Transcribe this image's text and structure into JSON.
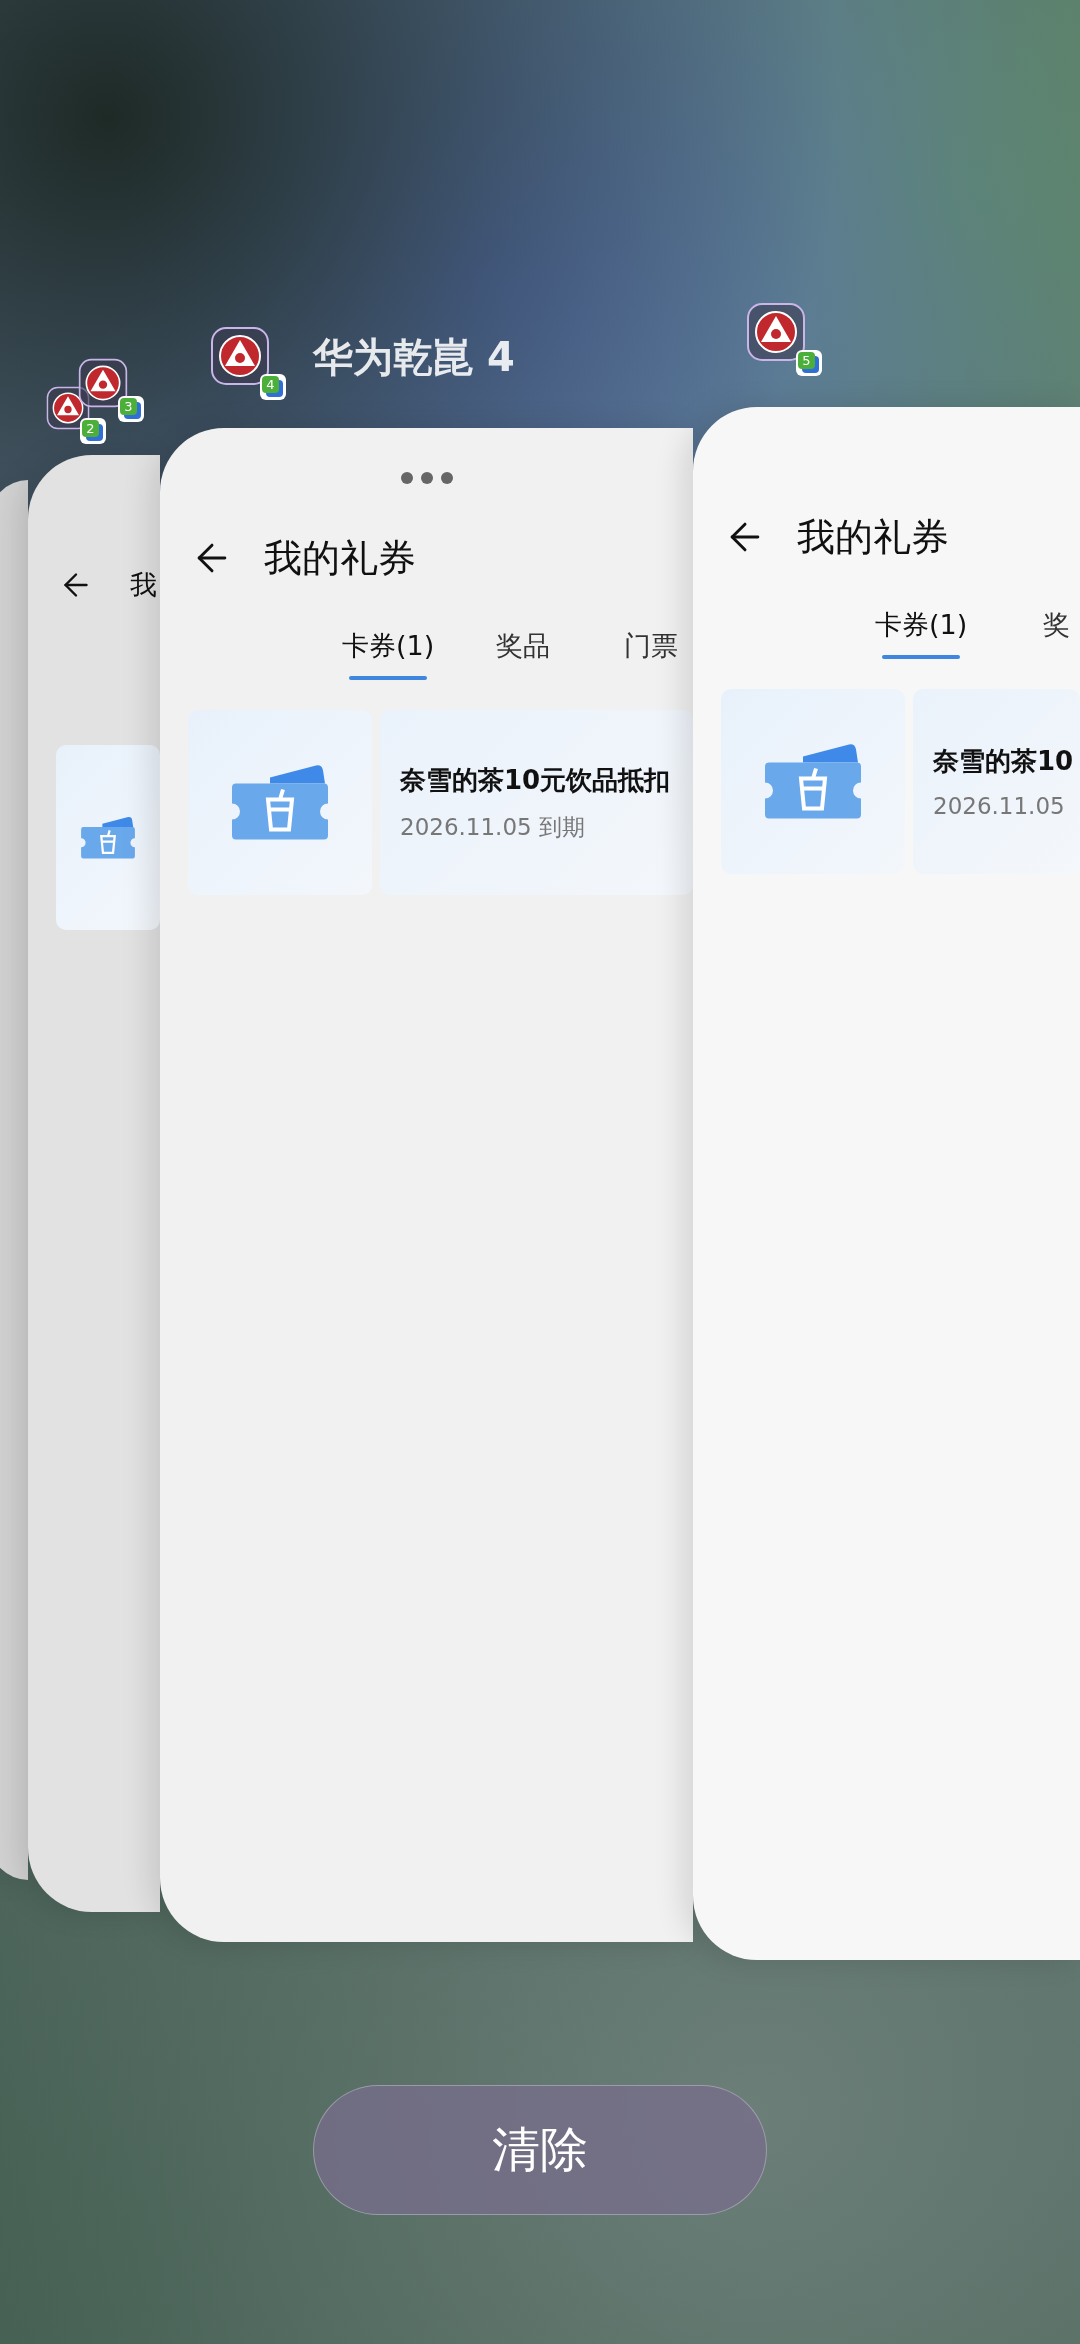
{
  "app_title": "华为乾崑 4",
  "windows": [
    {
      "badge": "2"
    },
    {
      "badge": "3",
      "title": "我",
      "has_coupon": true
    },
    {
      "badge": "4",
      "dots": true,
      "title": "我的礼券",
      "tabs": [
        {
          "label": "卡券(1)",
          "selected": true
        },
        {
          "label": "奖品",
          "selected": false
        },
        {
          "label": "门票",
          "selected": false
        }
      ],
      "coupon": {
        "name": "奈雪的茶10元饮品抵扣",
        "expiry": "2026.11.05 到期"
      }
    },
    {
      "badge": "5",
      "title": "我的礼券",
      "tabs": [
        {
          "label": "卡券(1)",
          "selected": true
        },
        {
          "label": "奖",
          "selected": false
        }
      ],
      "coupon": {
        "name": "奈雪的茶10",
        "expiry": "2026.11.05"
      }
    }
  ],
  "clear_button": "清除"
}
